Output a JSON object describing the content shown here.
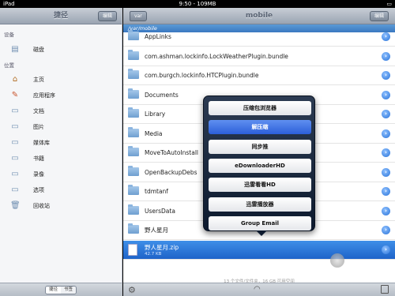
{
  "status": {
    "device": "iPad",
    "time": "9:50 - 109MB",
    "battery": "□"
  },
  "left": {
    "title": "捷径",
    "edit_label": "编辑",
    "section_device": "设备",
    "device_items": [
      {
        "label": "磁盘",
        "icon": "disk-icon"
      }
    ],
    "section_location": "位置",
    "location_items": [
      {
        "label": "主页",
        "icon": "home-icon"
      },
      {
        "label": "应用程序",
        "icon": "apps-icon"
      },
      {
        "label": "文档",
        "icon": "folder-icon"
      },
      {
        "label": "图片",
        "icon": "folder-icon"
      },
      {
        "label": "媒体库",
        "icon": "folder-icon"
      },
      {
        "label": "书籍",
        "icon": "folder-icon"
      },
      {
        "label": "录像",
        "icon": "folder-icon"
      },
      {
        "label": "选项",
        "icon": "folder-icon"
      },
      {
        "label": "回收站",
        "icon": "trash-icon"
      }
    ],
    "tabs": [
      "捷径",
      "书签"
    ]
  },
  "right": {
    "back_label": "var",
    "title": "mobile",
    "edit_label": "编辑",
    "path": "/var/mobile",
    "rows": [
      "AppLinks",
      "com.ashman.lockinfo.LockWeatherPlugin.bundle",
      "com.burgch.lockinfo.HTCPlugin.bundle",
      "Documents",
      "Library",
      "Media",
      "MoveToAutoInstall",
      "OpenBackupDebs",
      "tdmtanf",
      "UsersData",
      "野人星月"
    ],
    "selected": {
      "name": "野人星月.zip",
      "size": "42.7 KB"
    },
    "footer_count": "13 个文件/文件夹，16 GB 可用空间"
  },
  "popover": {
    "items": [
      "压缩包浏览器",
      "解压缩",
      "同步推",
      "eDownloaderHD",
      "迅雷看看HD",
      "迅雷播放器",
      "Group Email"
    ],
    "active_index": 1
  },
  "watermark": {
    "big": "威锋网",
    "small": "WeiPhone.com"
  },
  "colors": {
    "accent": "#2c5fd9",
    "path_blue": "#3a78c0"
  }
}
